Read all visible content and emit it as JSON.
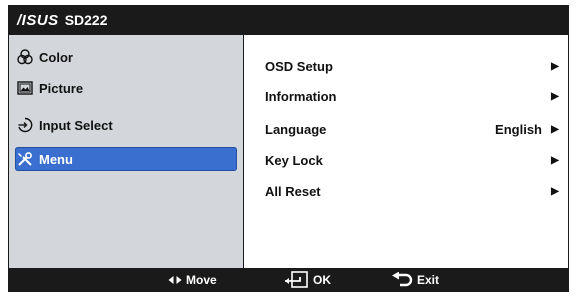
{
  "header": {
    "brand": "/ISUS",
    "model": "SD222"
  },
  "sidebar": {
    "items": [
      {
        "label": "Color",
        "icon": "color-icon"
      },
      {
        "label": "Picture",
        "icon": "picture-icon"
      },
      {
        "label": "Input Select",
        "icon": "input-select-icon"
      },
      {
        "label": "Menu",
        "icon": "tools-icon",
        "selected": true
      }
    ]
  },
  "content": {
    "items": [
      {
        "label": "OSD Setup",
        "value": ""
      },
      {
        "label": "Information",
        "value": ""
      },
      {
        "label": "Language",
        "value": "English"
      },
      {
        "label": "Key Lock",
        "value": ""
      },
      {
        "label": "All Reset",
        "value": ""
      }
    ]
  },
  "footer": {
    "move": "Move",
    "ok": "OK",
    "exit": "Exit"
  },
  "colors": {
    "accent": "#3a6fcf",
    "bar": "#1a1a1a",
    "sidebar": "#d3d6da"
  }
}
